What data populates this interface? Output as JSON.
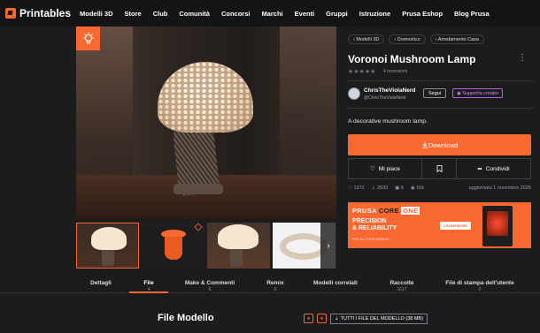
{
  "nav": {
    "brand": "Printables",
    "items": [
      "Modelli 3D",
      "Store",
      "Club",
      "Comunità",
      "Concorsi",
      "Marchi",
      "Eventi",
      "Gruppi",
      "Istruzione",
      "Prusa Eshop",
      "Blog Prusa"
    ]
  },
  "breadcrumbs": [
    "Modelli 3D",
    "Domestico",
    "Arredamento Casa"
  ],
  "model": {
    "title": "Voronoi Mushroom Lamp",
    "reviews": "4 recensioni",
    "author": "ChrisTheViolaNerd",
    "handle": "@ChrisTheViolaNerd",
    "follow_label": "Segui",
    "support_label": "Supporta creator",
    "description": "A decorative mushroom lamp.",
    "download_label": "Download",
    "like_label": "Mi piace",
    "share_label": "Condividi",
    "stats": {
      "likes": "1372",
      "downloads": "2593",
      "makes": "6",
      "views": "16k"
    },
    "updated": "aggiornato 1 novembre 2025"
  },
  "ad": {
    "brand_a": "PRUSA",
    "brand_b": "CORE",
    "brand_c": "ONE",
    "tagline_1": "PRECISION",
    "tagline_2": "& RELIABILITY",
    "small": "FOR ALL YOUR MODELS",
    "cta": "LEARN MORE"
  },
  "tabs": [
    {
      "label": "Dettagli",
      "count": ""
    },
    {
      "label": "File",
      "count": "4"
    },
    {
      "label": "Make & Commenti",
      "count": "6"
    },
    {
      "label": "Remix",
      "count": "0"
    },
    {
      "label": "Modelli correlati",
      "count": ""
    },
    {
      "label": "Raccolte",
      "count": "1617"
    },
    {
      "label": "File di stampa dell'utente",
      "count": "0"
    }
  ],
  "files": {
    "title": "File Modello",
    "all_files_label": "TUTTI I FILE DEL MODELLO (38 MB)"
  },
  "colors": {
    "accent": "#fa6831",
    "background": "#1b1c1e",
    "nav": "#131416"
  }
}
